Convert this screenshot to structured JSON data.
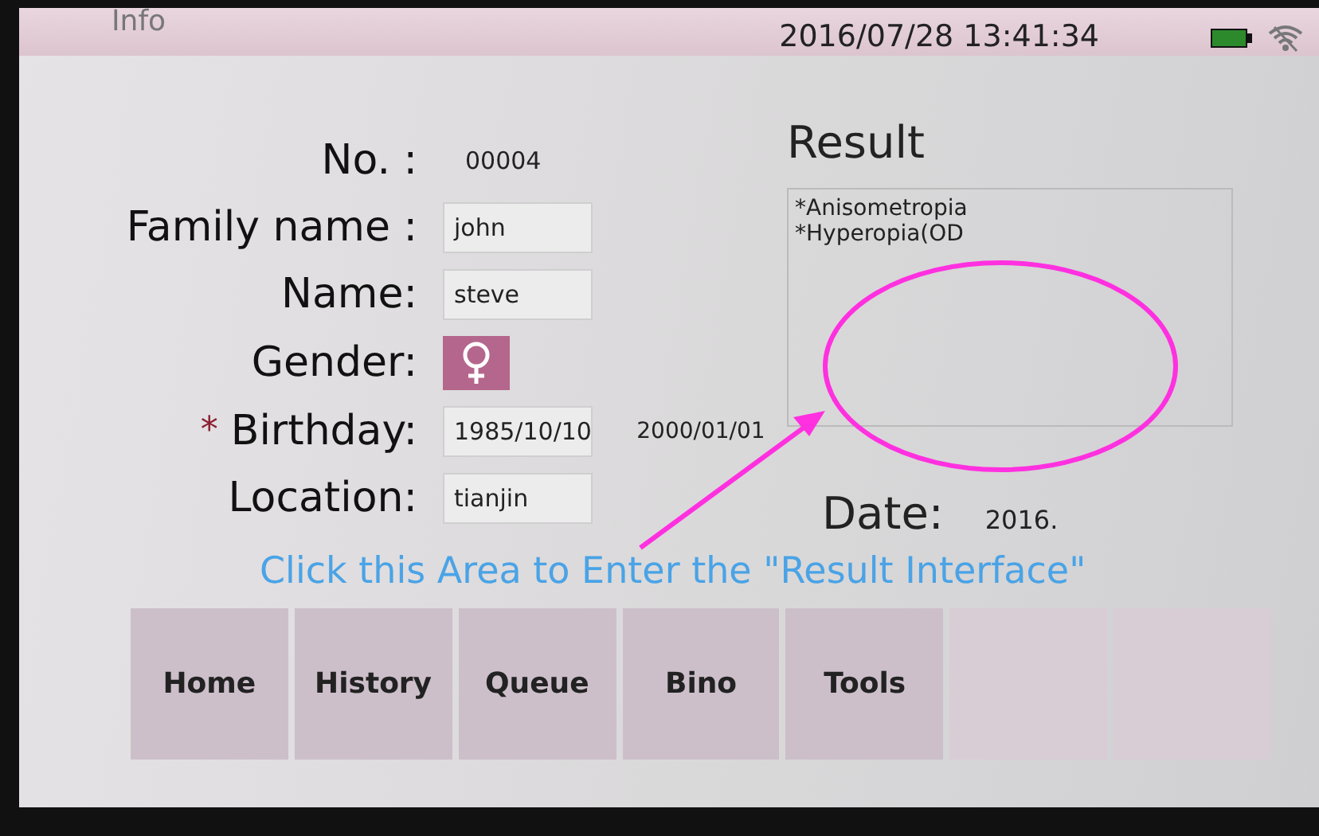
{
  "header": {
    "title": "Info",
    "datetime": "2016/07/28 13:41:34"
  },
  "form": [
    {
      "kind": "plain",
      "label": "No. :",
      "value": "00004"
    },
    {
      "kind": "input",
      "label": "Family name :",
      "value": "john"
    },
    {
      "kind": "input",
      "label": "Name:",
      "value": "steve"
    },
    {
      "kind": "gender",
      "label": "Gender:"
    },
    {
      "kind": "input",
      "label": "Birthday:",
      "value": "1985/10/10",
      "extra": "2000/01/01",
      "mark": "*"
    },
    {
      "kind": "input",
      "label": "Location:",
      "value": "tianjin"
    }
  ],
  "result": {
    "title": "Result",
    "items": [
      "*Anisometropia",
      "*Hyperopia(OD"
    ],
    "date_label": "Date:",
    "date_value": "2016."
  },
  "nav": [
    {
      "label": "Home",
      "disabled": false
    },
    {
      "label": "History",
      "disabled": false
    },
    {
      "label": "Queue",
      "disabled": false
    },
    {
      "label": "Bino",
      "disabled": false
    },
    {
      "label": "Tools",
      "disabled": false
    },
    {
      "disabled": true
    },
    {
      "disabled": true
    }
  ],
  "annotation": {
    "caption": "Click this Area to Enter the \"Result Interface\""
  }
}
